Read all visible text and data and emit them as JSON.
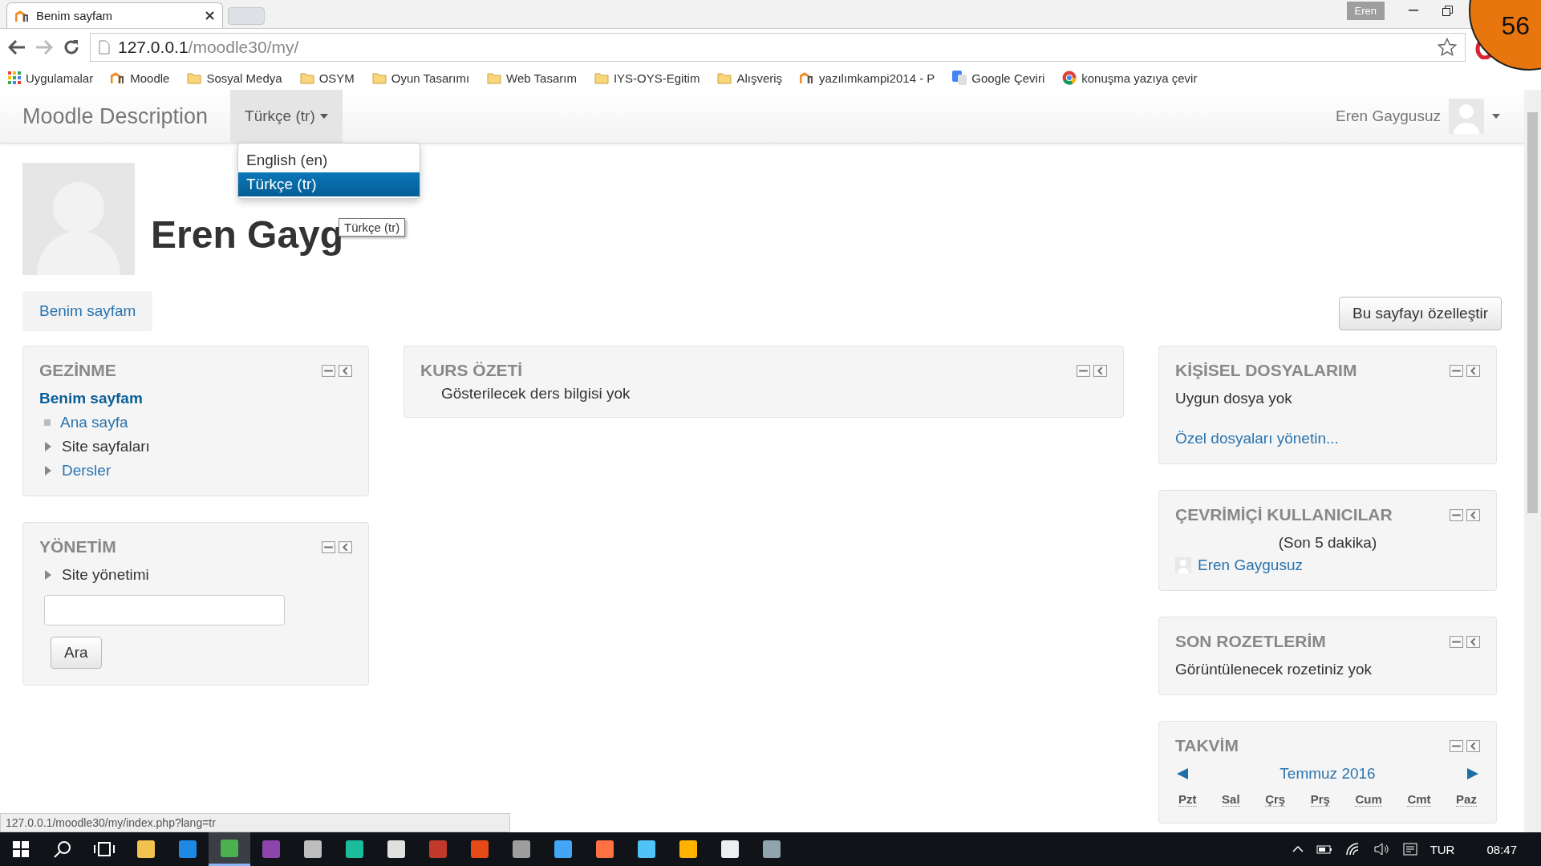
{
  "browser": {
    "tab": {
      "title": "Benim sayfam"
    },
    "profile": "Eren",
    "address": {
      "host": "127.0.0.1",
      "path": "/moodle30/my/"
    },
    "bookmarks": [
      {
        "kind": "apps",
        "label": "Uygulamalar"
      },
      {
        "kind": "site",
        "label": "Moodle"
      },
      {
        "kind": "folder",
        "label": "Sosyal Medya"
      },
      {
        "kind": "folder",
        "label": "OSYM"
      },
      {
        "kind": "folder",
        "label": "Oyun Tasarımı"
      },
      {
        "kind": "folder",
        "label": "Web Tasarım"
      },
      {
        "kind": "folder",
        "label": "IYS-OYS-Egitim"
      },
      {
        "kind": "folder",
        "label": "Alışveriş"
      },
      {
        "kind": "site",
        "label": "yazılımkampi2014 - P"
      },
      {
        "kind": "translate",
        "label": "Google Çeviri"
      },
      {
        "kind": "chrome",
        "label": "konuşma yazıya çevir"
      }
    ],
    "status_url": "127.0.0.1/moodle30/my/index.php?lang=tr"
  },
  "counter_badge": "56",
  "navbar": {
    "brand": "Moodle Description",
    "language_menu": {
      "label": "Türkçe (tr)",
      "expanded": true,
      "options": [
        {
          "label": "English (en)",
          "selected": false
        },
        {
          "label": "Türkçe (tr)",
          "selected": true
        }
      ],
      "tooltip": "Türkçe (tr)"
    },
    "user": "Eren Gaygusuz"
  },
  "page": {
    "heading": "Eren Gayg",
    "tab": "Benim sayfam",
    "customize_button": "Bu sayfayı özelleştir"
  },
  "navigation": {
    "title": "GEZİNME",
    "root": "Benim sayfam",
    "children": [
      {
        "label": "Ana sayfa",
        "kind": "leaf",
        "link": true
      },
      {
        "label": "Site sayfaları",
        "kind": "branch",
        "link": false
      },
      {
        "label": "Dersler",
        "kind": "branch",
        "link": true
      }
    ]
  },
  "administration": {
    "title": "YÖNETİM",
    "items": [
      {
        "label": "Site yönetimi",
        "kind": "branch",
        "link": false
      }
    ],
    "search_button": "Ara"
  },
  "course_overview": {
    "title": "KURS ÖZETİ",
    "message": "Gösterilecek ders bilgisi yok"
  },
  "private_files": {
    "title": "KİŞİSEL DOSYALARIM",
    "message": "Uygun dosya yok",
    "link": "Özel dosyaları yönetin..."
  },
  "online_users": {
    "title": "ÇEVRİMİÇİ KULLANICILAR",
    "period": "(Son 5 dakika)",
    "users": [
      "Eren Gaygusuz"
    ]
  },
  "latest_badges": {
    "title": "SON ROZETLERİM",
    "message": "Görüntülenecek rozetiniz yok"
  },
  "calendar": {
    "title": "TAKVİM",
    "month": "Temmuz 2016",
    "days": [
      "Pzt",
      "Sal",
      "Çrş",
      "Prş",
      "Cum",
      "Cmt",
      "Paz"
    ]
  },
  "taskbar": {
    "apps": [
      {
        "color": "#f2c14e",
        "selected": false
      },
      {
        "color": "#1e88e5",
        "selected": false
      },
      {
        "color": "#4caf50",
        "selected": true
      },
      {
        "color": "#8e44ad",
        "selected": false
      },
      {
        "color": "#bdbdbd",
        "selected": false
      },
      {
        "color": "#1abc9c",
        "selected": false
      },
      {
        "color": "#e0e0e0",
        "selected": false
      },
      {
        "color": "#c0392b",
        "selected": false
      },
      {
        "color": "#e64a19",
        "selected": false
      },
      {
        "color": "#9e9e9e",
        "selected": false
      },
      {
        "color": "#42a5f5",
        "selected": false
      },
      {
        "color": "#ff7043",
        "selected": false
      },
      {
        "color": "#4fc3f7",
        "selected": false
      },
      {
        "color": "#ffb300",
        "selected": false
      },
      {
        "color": "#eceff1",
        "selected": false
      },
      {
        "color": "#90a4ae",
        "selected": false
      }
    ],
    "language": "TUR",
    "time": "08:47"
  }
}
